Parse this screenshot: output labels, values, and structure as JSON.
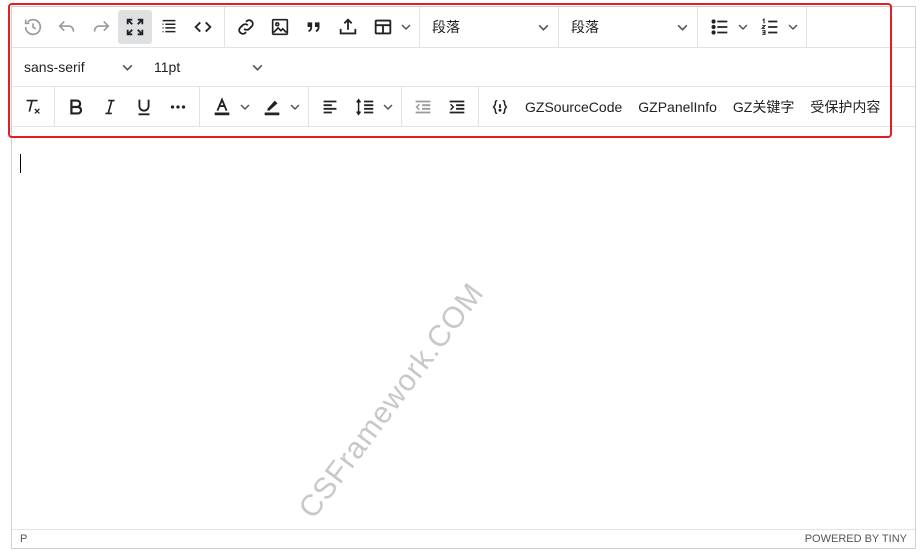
{
  "toolbar": {
    "format_select_1": "段落",
    "format_select_2": "段落",
    "font_family": "sans-serif",
    "font_size": "11pt",
    "custom_buttons": [
      "GZSourceCode",
      "GZPanelInfo",
      "GZ关键字",
      "受保护内容"
    ]
  },
  "content": {
    "watermark": "CSFramework.COM"
  },
  "statusbar": {
    "path": "P",
    "branding": "POWERED BY TINY"
  },
  "colors": {
    "highlight_border": "#e02020",
    "active_button_bg": "#dee0e2",
    "disabled_icon": "#9a9a9a"
  }
}
